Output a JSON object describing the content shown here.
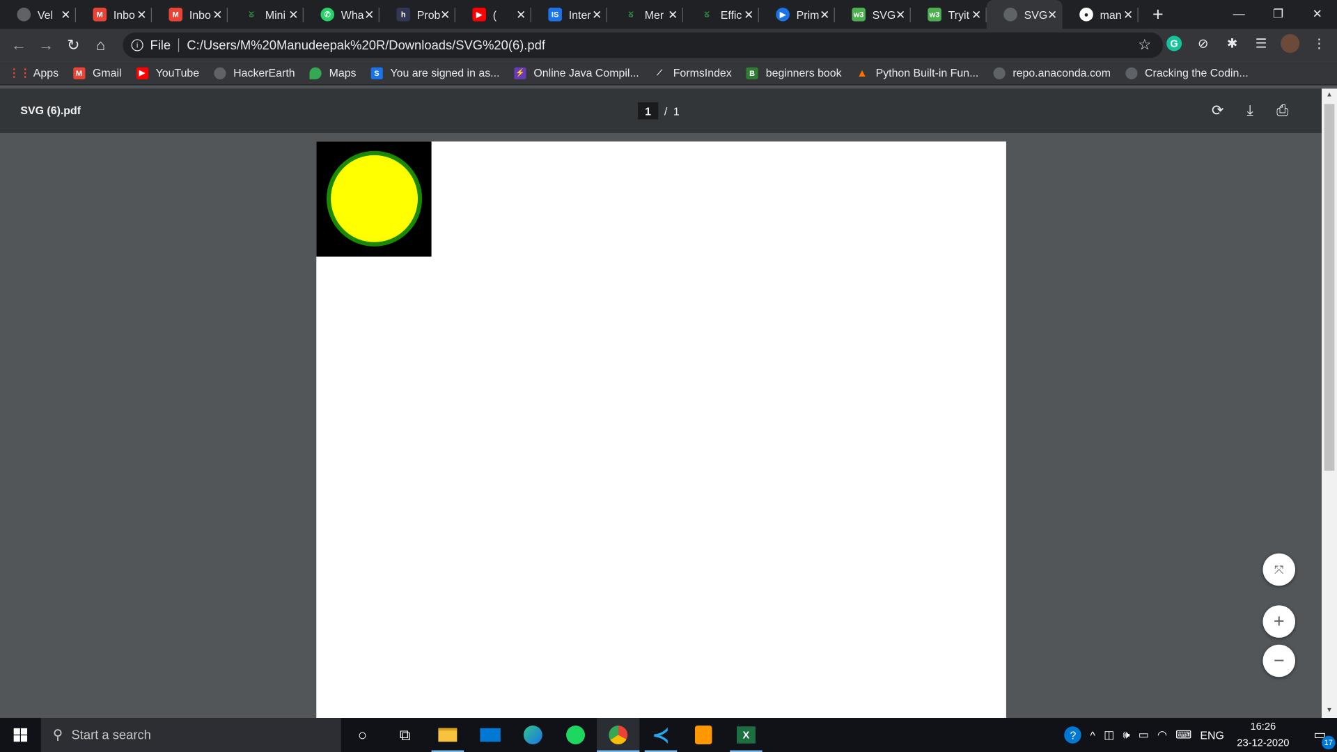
{
  "tabs": [
    {
      "title": "Vel",
      "icon": "globe-icon",
      "color": "#5f6368"
    },
    {
      "title": "Inbo",
      "icon": "gmail-icon",
      "color": "#ea4335"
    },
    {
      "title": "Inbo",
      "icon": "gmail-icon",
      "color": "#ea4335"
    },
    {
      "title": "Mini",
      "icon": "gfg-icon",
      "color": "#2f8d46"
    },
    {
      "title": "Wha",
      "icon": "whatsapp-icon",
      "color": "#25d366"
    },
    {
      "title": "Prob",
      "icon": "hackerearth-icon",
      "color": "#323754"
    },
    {
      "title": "(",
      "icon": "youtube-icon",
      "color": "#ff0000"
    },
    {
      "title": "Inter",
      "icon": "interviewbit-icon",
      "color": "#1a73e8"
    },
    {
      "title": "Mer",
      "icon": "gfg-icon",
      "color": "#2f8d46"
    },
    {
      "title": "Effic",
      "icon": "gfg-icon",
      "color": "#2f8d46"
    },
    {
      "title": "Prim",
      "icon": "play-circle-icon",
      "color": "#1a73e8"
    },
    {
      "title": "SVG",
      "icon": "w3schools-icon",
      "color": "#4caf50"
    },
    {
      "title": "Tryit",
      "icon": "w3schools-icon",
      "color": "#4caf50"
    },
    {
      "title": "SVG",
      "icon": "globe-icon",
      "color": "#5f6368",
      "active": true
    },
    {
      "title": "man",
      "icon": "github-icon",
      "color": "#ffffff"
    }
  ],
  "toolbar": {
    "file_label": "File",
    "url": "C:/Users/M%20Manudeepak%20R/Downloads/SVG%20(6).pdf"
  },
  "bookmarks": [
    {
      "label": "Apps",
      "icon": "apps-grid-icon",
      "color": "#ea4335"
    },
    {
      "label": "Gmail",
      "icon": "gmail-icon",
      "color": "#ea4335"
    },
    {
      "label": "YouTube",
      "icon": "youtube-icon",
      "color": "#ff0000"
    },
    {
      "label": "HackerEarth",
      "icon": "globe-icon",
      "color": "#5f6368"
    },
    {
      "label": "Maps",
      "icon": "maps-pin-icon",
      "color": "#34a853"
    },
    {
      "label": "You are signed in as...",
      "icon": "s-icon",
      "color": "#1a73e8"
    },
    {
      "label": "Online Java Compil...",
      "icon": "bolt-icon",
      "color": "#673ab7"
    },
    {
      "label": "FormsIndex",
      "icon": "formsindex-icon",
      "color": "#35363a"
    },
    {
      "label": "beginners book",
      "icon": "b-icon",
      "color": "#2e7d32"
    },
    {
      "label": "Python Built-in Fun...",
      "icon": "python-icon",
      "color": "#ff6f00"
    },
    {
      "label": "repo.anaconda.com",
      "icon": "globe-icon",
      "color": "#5f6368"
    },
    {
      "label": "Cracking the Codin...",
      "icon": "globe-icon",
      "color": "#5f6368"
    }
  ],
  "pdf": {
    "filename": "SVG (6).pdf",
    "current_page": "1",
    "separator": "/",
    "total_pages": "1",
    "colors": {
      "circle_fill": "#ffff00",
      "circle_stroke": "#1a8a00",
      "square": "#000000"
    }
  },
  "taskbar": {
    "search_placeholder": "Start a search",
    "language": "ENG",
    "time": "16:26",
    "date": "23-12-2020",
    "notification_count": "17"
  }
}
